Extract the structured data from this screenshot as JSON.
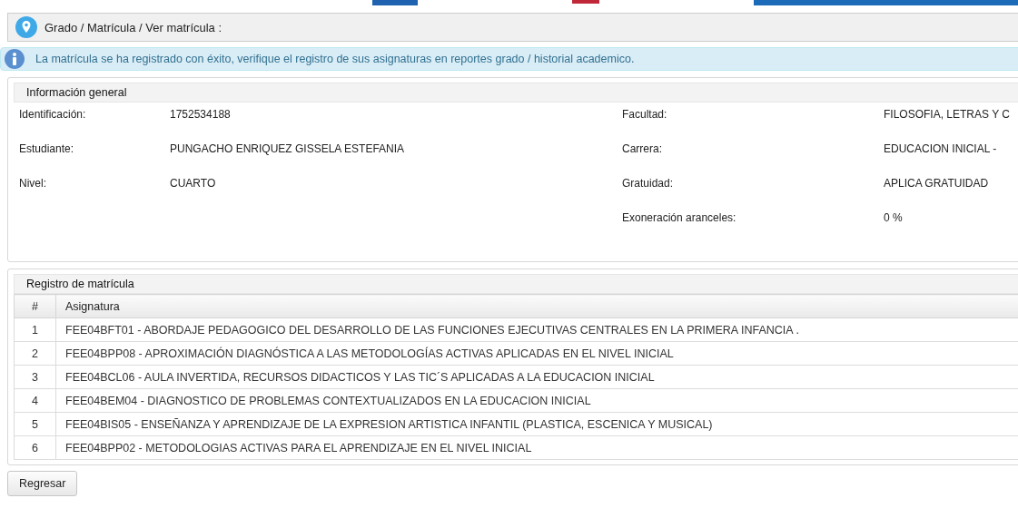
{
  "breadcrumb": "Grado / Matrícula / Ver matrícula :",
  "alert": {
    "message": "La matrícula se ha registrado con éxito, verifique el registro de sus asignaturas en reportes grado / historial academico."
  },
  "general_info": {
    "title": "Información general",
    "left": [
      {
        "label": "Identificación:",
        "value": "1752534188"
      },
      {
        "label": "Estudiante:",
        "value": "PUNGACHO ENRIQUEZ GISSELA ESTEFANIA"
      },
      {
        "label": "Nivel:",
        "value": "CUARTO"
      }
    ],
    "right": [
      {
        "label": "Facultad:",
        "value": "FILOSOFIA, LETRAS Y C"
      },
      {
        "label": "Carrera:",
        "value": "EDUCACION INICIAL -"
      },
      {
        "label": "Gratuidad:",
        "value": "APLICA GRATUIDAD"
      },
      {
        "label": "Exoneración aranceles:",
        "value": "0 %"
      }
    ]
  },
  "registration": {
    "title": "Registro de matrícula",
    "columns": [
      "#",
      "Asignatura"
    ],
    "rows": [
      [
        "1",
        "FEE04BFT01 - ABORDAJE PEDAGOGICO DEL DESARROLLO DE LAS FUNCIONES EJECUTIVAS CENTRALES EN LA PRIMERA INFANCIA ."
      ],
      [
        "2",
        "FEE04BPP08 - APROXIMACIÓN DIAGNÓSTICA A LAS METODOLOGÍAS ACTIVAS APLICADAS EN EL NIVEL INICIAL"
      ],
      [
        "3",
        "FEE04BCL06 - AULA INVERTIDA, RECURSOS DIDACTICOS Y LAS TIC´S APLICADAS A LA EDUCACION INICIAL"
      ],
      [
        "4",
        "FEE04BEM04 - DIAGNOSTICO DE PROBLEMAS CONTEXTUALIZADOS EN LA EDUCACION INICIAL"
      ],
      [
        "5",
        "FEE04BIS05 - ENSEÑANZA Y APRENDIZAJE DE LA EXPRESION ARTISTICA INFANTIL (PLASTICA, ESCENICA Y MUSICAL)"
      ],
      [
        "6",
        "FEE04BPP02 - METODOLOGIAS ACTIVAS PARA EL APRENDIZAJE EN EL NIVEL INICIAL"
      ]
    ]
  },
  "buttons": [
    "Regresar"
  ]
}
